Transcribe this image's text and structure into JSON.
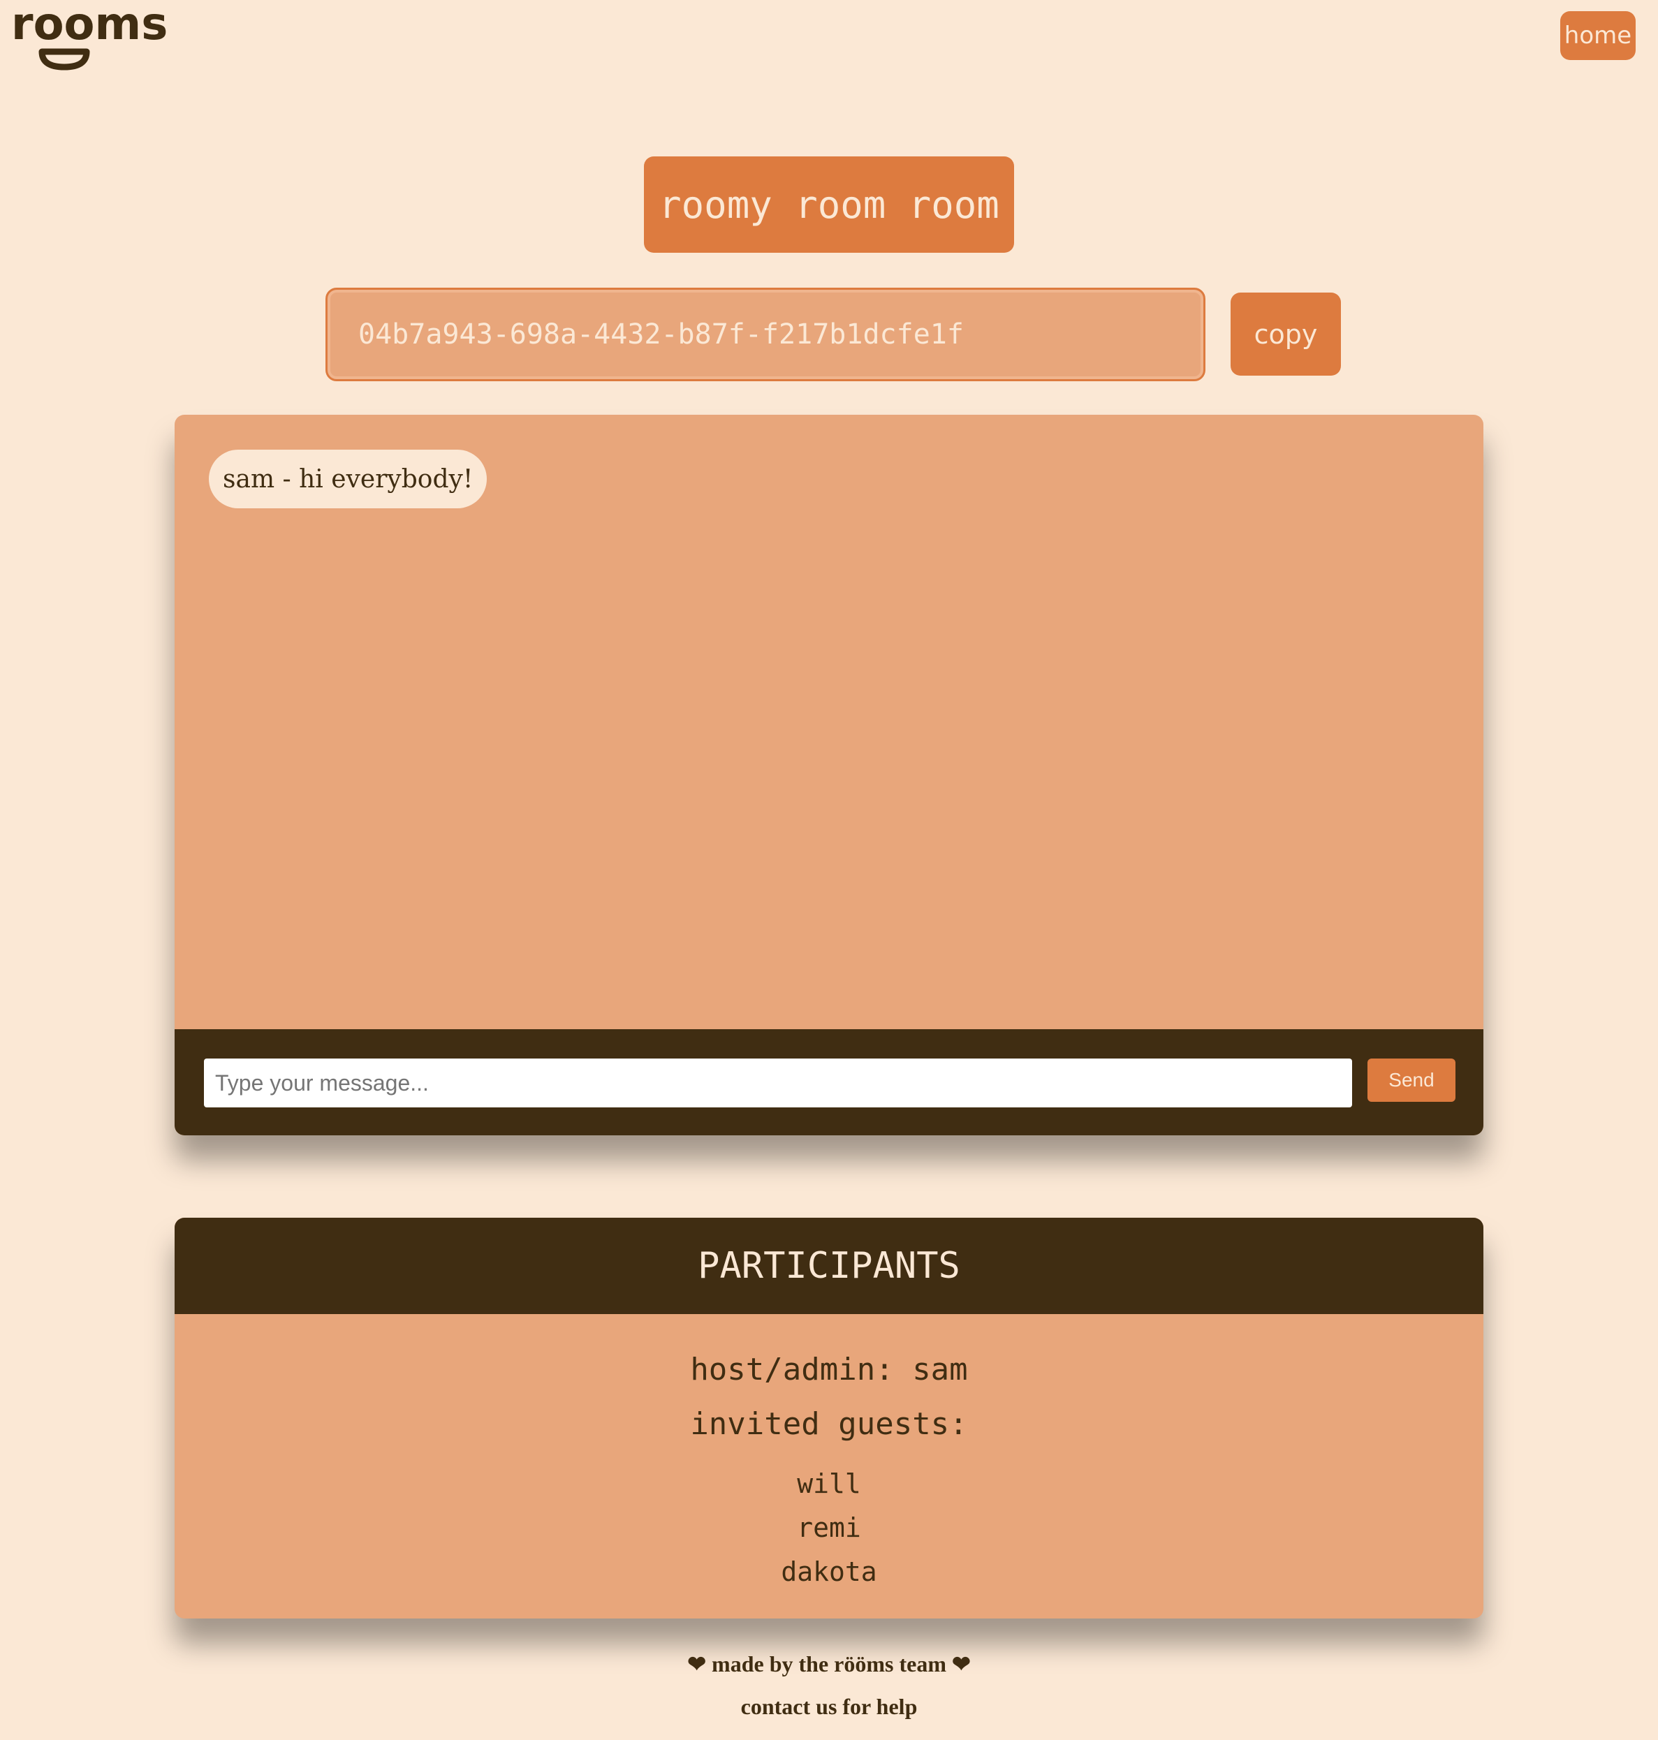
{
  "logo": {
    "text": "rooms"
  },
  "nav": {
    "home_label": "home"
  },
  "room": {
    "title": "roomy room room",
    "id": "04b7a943-698a-4432-b87f-f217b1dcfe1f",
    "copy_label": "copy"
  },
  "chat": {
    "messages": [
      {
        "text": "sam - hi everybody!"
      }
    ],
    "input_placeholder": "Type your message...",
    "send_label": "Send"
  },
  "participants": {
    "heading": "PARTICIPANTS",
    "host_line": "host/admin: sam",
    "guests_heading": "invited guests:",
    "guests": [
      "will",
      "remi",
      "dakota"
    ]
  },
  "footer": {
    "made_by": "❤ made by the rööms team ❤",
    "contact": "contact us for help"
  },
  "colors": {
    "background": "#fbe8d5",
    "accent": "#dd7b3f",
    "panel": "#e8a67b",
    "dark": "#402d12"
  }
}
